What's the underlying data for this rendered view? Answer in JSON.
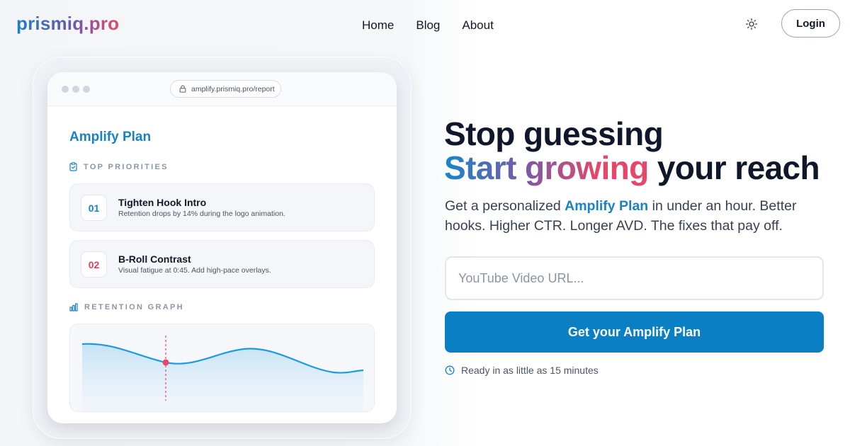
{
  "brand": {
    "logo_text": "prismiq.pro"
  },
  "nav": {
    "links": [
      {
        "label": "Home"
      },
      {
        "label": "Blog"
      },
      {
        "label": "About"
      }
    ],
    "theme_icon": "sun-icon",
    "login_label": "Login"
  },
  "mockup": {
    "url": "amplify.prismiq.pro/report",
    "plan_title": "Amplify Plan",
    "priorities_label": "TOP PRIORITIES",
    "priorities": [
      {
        "number": "01",
        "title": "Tighten Hook Intro",
        "description": "Retention drops by 14% during the logo animation.",
        "number_color": "#1a82c4"
      },
      {
        "number": "02",
        "title": "B-Roll Contrast",
        "description": "Visual fatigue at 0:45. Add high-pace overlays.",
        "number_color": "#e0405f"
      }
    ],
    "graph_label": "RETENTION GRAPH",
    "icons": {
      "priorities": "clipboard-icon",
      "graph": "bar-chart-icon",
      "url": "lock-icon"
    }
  },
  "hero": {
    "headline_line1": "Stop guessing",
    "headline_line2_accent": "Start growing",
    "headline_line2_rest": " your reach",
    "subtext_before": "Get a personalized ",
    "subtext_highlight": "Amplify Plan",
    "subtext_after": " in under an hour. Better hooks. Higher CTR. Longer AVD. The fixes that pay off.",
    "input_placeholder": "YouTube Video URL...",
    "cta_label": "Get your Amplify Plan",
    "ready_text": "Ready in as little as 15 minutes",
    "ready_icon": "clock-icon"
  },
  "colors": {
    "accent_blue": "#0a7fc4",
    "accent_pink": "#e4476a",
    "accent_purple": "#7a5aa6"
  }
}
